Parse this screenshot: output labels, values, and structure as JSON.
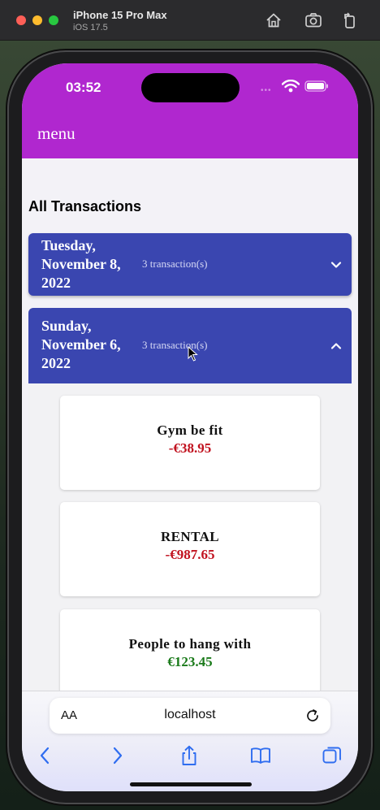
{
  "simulator": {
    "device": "iPhone 15 Pro Max",
    "os": "iOS 17.5"
  },
  "status_bar": {
    "time": "03:52",
    "signal": "•••"
  },
  "app": {
    "menu_label": "menu",
    "page_title": "All Transactions",
    "groups": [
      {
        "date": "Tuesday, November 8, 2022",
        "count": "3 transaction(s)",
        "expanded": false
      },
      {
        "date": "Sunday, November 6, 2022",
        "count": "3 transaction(s)",
        "expanded": true
      }
    ],
    "transactions": [
      {
        "name": "Gym be fit",
        "amount": "-€38.95"
      },
      {
        "name": "RENTAL",
        "amount": "-€987.65"
      },
      {
        "name": "People to hang with",
        "amount": "€123.45"
      }
    ]
  },
  "browser": {
    "text_size_label": "AA",
    "url": "localhost"
  },
  "colors": {
    "header": "#b027cf",
    "group": "#3a46b0",
    "negative": "#c1121f",
    "positive": "#1a7a1a"
  },
  "icons": [
    "home-icon",
    "screenshot-icon",
    "rotate-icon",
    "wifi-icon",
    "battery-icon",
    "chevron-down-icon",
    "chevron-up-icon",
    "reload-icon",
    "back-icon",
    "forward-icon",
    "share-icon",
    "bookmarks-icon",
    "tabs-icon",
    "pointer-cursor-icon"
  ]
}
